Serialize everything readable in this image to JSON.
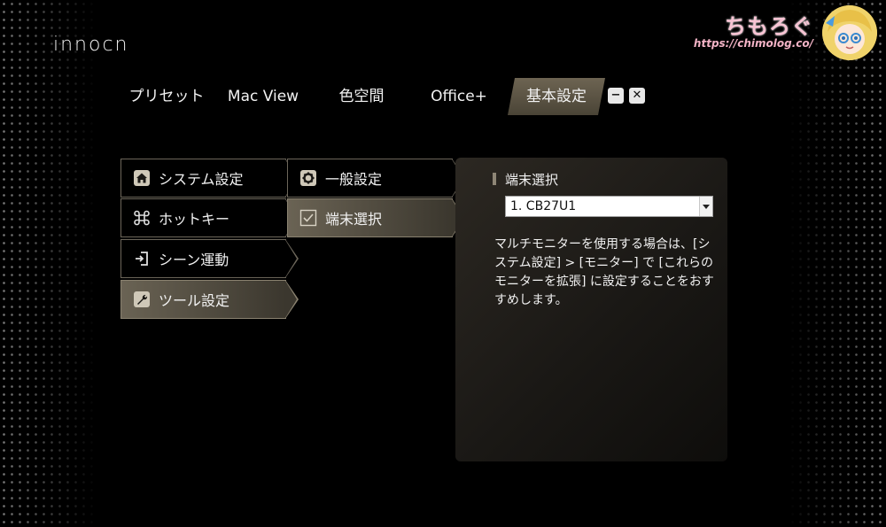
{
  "app": {
    "logo": "innocn"
  },
  "watermark": {
    "title": "ちもろぐ",
    "url": "https://chimolog.co/"
  },
  "tabs": [
    {
      "label": "プリセット"
    },
    {
      "label": "Mac View"
    },
    {
      "label": "色空間"
    },
    {
      "label": "Office+"
    },
    {
      "label": "基本設定",
      "active": true
    }
  ],
  "window_controls": {
    "minimize": "−",
    "close": "✕"
  },
  "sidebar": {
    "items": [
      {
        "label": "システム設定",
        "icon": "home-icon"
      },
      {
        "label": "ホットキー",
        "icon": "command-key-icon"
      },
      {
        "label": "シーン運動",
        "icon": "sign-in-icon"
      },
      {
        "label": "ツール設定",
        "icon": "wrench-icon",
        "active": true
      }
    ]
  },
  "submenu": {
    "items": [
      {
        "label": "一般設定",
        "icon": "gear-icon"
      },
      {
        "label": "端末選択",
        "icon": "checkbox-icon",
        "active": true
      }
    ]
  },
  "panel": {
    "title": "端末選択",
    "select_value": "1. CB27U1",
    "description": "マルチモニターを使用する場合は、[システム設定] > [モニター] で [これらのモニターを拡張] に設定することをおすすめします。"
  },
  "colors": {
    "background": "#000000",
    "active_gold": "#6a6354",
    "border": "#6c665a",
    "watermark_pink": "#f7c3d3"
  }
}
